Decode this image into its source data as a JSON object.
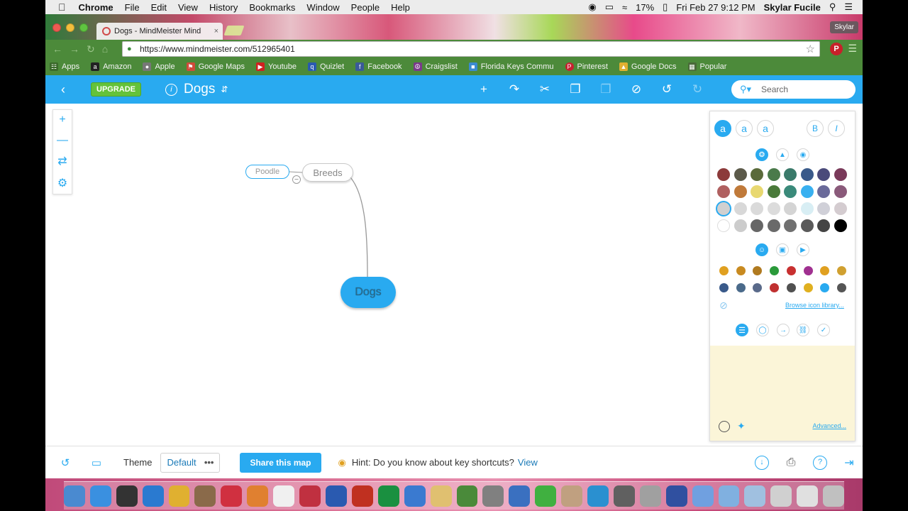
{
  "menubar": {
    "app": "Chrome",
    "items": [
      "File",
      "Edit",
      "View",
      "History",
      "Bookmarks",
      "Window",
      "People",
      "Help"
    ],
    "battery": "17%",
    "clock": "Fri Feb 27  9:12 PM",
    "user": "Skylar Fucile"
  },
  "tab": {
    "title": "Dogs - MindMeister Mind",
    "profile": "Skylar"
  },
  "omnibox": {
    "url": "https://www.mindmeister.com/512965401"
  },
  "bookmarks": [
    "Apps",
    "Amazon",
    "Apple",
    "Google Maps",
    "Youtube",
    "Quizlet",
    "Facebook",
    "Craigslist",
    "Florida Keys Commu",
    "Pinterest",
    "Google Docs",
    "Popular"
  ],
  "mm": {
    "upgrade": "UPGRADE",
    "map_title": "Dogs",
    "search_placeholder": "Search"
  },
  "map": {
    "nodes": {
      "poodle": "Poodle",
      "breeds": "Breeds",
      "dogs": "Dogs"
    }
  },
  "panel": {
    "font_a": "a",
    "bold": "B",
    "italic": "I",
    "browse_link": "Browse icon library...",
    "advanced_link": "Advanced..."
  },
  "palette": [
    [
      "#8c3a3a",
      "#5c5a4a",
      "#5a6a3a",
      "#4a7a4a",
      "#3a7a6a",
      "#3a5a8a",
      "#4a4a7a",
      "#7a3a5a"
    ],
    [
      "#b06060",
      "#c07a3a",
      "#e8d870",
      "#4a7a3a",
      "#3a8a7a",
      "#39b0f0",
      "#6a6a9a",
      "#8a5a7a"
    ],
    [
      "#d0d0d0",
      "#d8d8d8",
      "#dadada",
      "#dcdcdc",
      "#d4d4d4",
      "#d8eef4",
      "#d0d0d8",
      "#d4ccd0"
    ],
    [
      "#ffffff",
      "#cccccc",
      "#666666",
      "#6a6a6a",
      "#707070",
      "#5a5a5a",
      "#444444",
      "#000000"
    ]
  ],
  "icons": [
    [
      "#e0a020",
      "#c88a20",
      "#b07a20",
      "#2a9a3a",
      "#c83030",
      "#a03090",
      "#e0a020",
      "#d0a030"
    ],
    [
      "#3a5a8a",
      "#4a6a8a",
      "#5a6a8a",
      "#c03030",
      "#505050",
      "#e0b020",
      "#29aaf0",
      "#555555"
    ]
  ],
  "bottom": {
    "theme_label": "Theme",
    "theme_value": "Default",
    "share": "Share this map",
    "hint": "Hint: Do you know about key shortcuts?",
    "hint_link": "View"
  },
  "dock_colors": [
    "#4a8ad0",
    "#3a90e0",
    "#333333",
    "#2a7ad0",
    "#e0b030",
    "#8a6a4a",
    "#d03040",
    "#e08030",
    "#f0f0f0",
    "#c03040",
    "#2a5ab0",
    "#c03020",
    "#1a9040",
    "#3a7ad0",
    "#e0c070",
    "#4a8a3a",
    "#808080",
    "#3a70c0",
    "#40b040",
    "#c0a080",
    "#2a90d0",
    "#606060",
    "#a0a0a0",
    "#3050a0",
    "#70a0e0",
    "#80b0e0",
    "#a0c0e0",
    "#d0d0d0",
    "#e0e0e0",
    "#c0c0c0"
  ]
}
